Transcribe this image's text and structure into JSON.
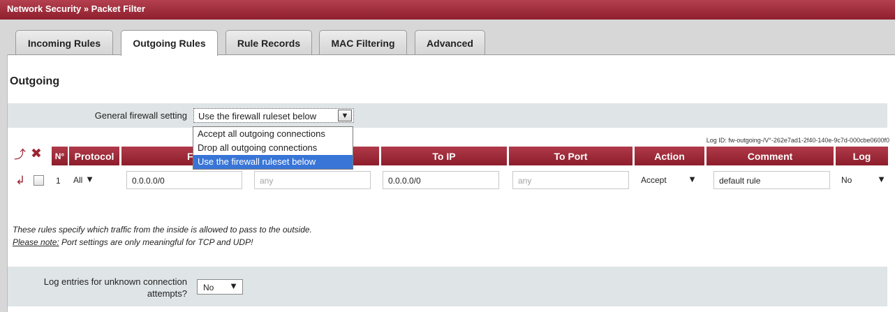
{
  "window": {
    "breadcrumb": "Network Security » Packet Filter"
  },
  "tabs": [
    {
      "label": "Incoming Rules",
      "active": false
    },
    {
      "label": "Outgoing Rules",
      "active": true
    },
    {
      "label": "Rule Records",
      "active": false
    },
    {
      "label": "MAC Filtering",
      "active": false
    },
    {
      "label": "Advanced",
      "active": false
    }
  ],
  "section": {
    "heading": "Outgoing"
  },
  "general_setting": {
    "label": "General firewall setting",
    "value": "Use the firewall ruleset below",
    "options": [
      "Accept all outgoing connections",
      "Drop all outgoing connections",
      "Use the firewall ruleset below"
    ],
    "selected_index": 2
  },
  "log_id": {
    "text": "Log ID: fw-outgoing-/V°-262e7ad1-2f40-140e-9c7d-000cbe0600f0"
  },
  "table": {
    "headers": {
      "no": "N°",
      "protocol": "Protocol",
      "from": "From",
      "to_ip": "To IP",
      "to_port": "To Port",
      "action": "Action",
      "comment": "Comment",
      "log": "Log"
    },
    "rows": [
      {
        "no": "1",
        "protocol": "All",
        "from_ip": "0.0.0.0/0",
        "from_port_placeholder": "any",
        "to_ip": "0.0.0.0/0",
        "to_port_placeholder": "any",
        "action": "Accept",
        "comment": "default rule",
        "log": "No"
      }
    ]
  },
  "notes": {
    "line1": "These rules specify which traffic from the inside is allowed to pass to the outside.",
    "note_label": "Please note:",
    "note_text": " Port settings are only meaningful for TCP and UDP!"
  },
  "unknown_log": {
    "label_line1": "Log entries for unknown connection",
    "label_line2": "attempts?",
    "value": "No"
  },
  "colors": {
    "header_red": "#9a2636",
    "row_bg": "#dfe4e6",
    "selected_blue": "#3875d7"
  },
  "icons": [
    "add-rule-icon",
    "delete-rule-icon",
    "move-rule-icon",
    "chevron-down-icon"
  ]
}
